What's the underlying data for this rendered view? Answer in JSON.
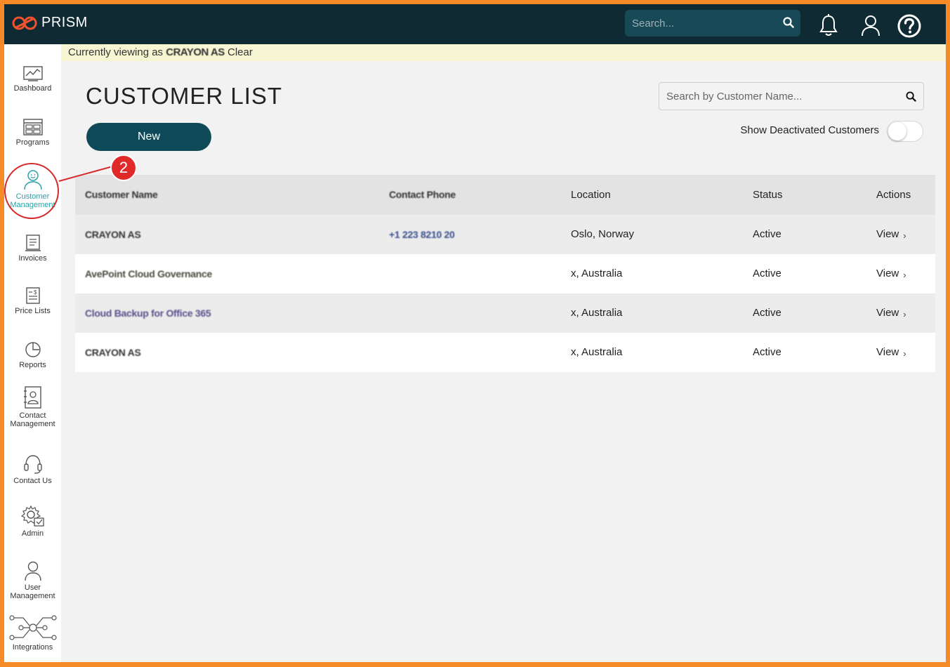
{
  "app": {
    "name": "PRISM"
  },
  "topbar": {
    "search_placeholder": "Search..."
  },
  "sidebar": {
    "items": [
      {
        "label": "Dashboard"
      },
      {
        "label": "Programs"
      },
      {
        "label": "Customer Management"
      },
      {
        "label": "Invoices"
      },
      {
        "label": "Price Lists"
      },
      {
        "label": "Reports"
      },
      {
        "label": "Contact Management"
      },
      {
        "label": "Contact Us"
      },
      {
        "label": "Admin"
      },
      {
        "label": "User Management"
      },
      {
        "label": "Integrations"
      }
    ]
  },
  "banner": {
    "lead": "Currently viewing as",
    "customer": "CRAYON AS",
    "clear": "Clear"
  },
  "page": {
    "title": "CUSTOMER LIST",
    "new_button": "New",
    "search_placeholder": "Search by Customer Name...",
    "toggle_label": "Show Deactivated Customers",
    "toggle_on": false
  },
  "annotation": {
    "number": "2"
  },
  "table": {
    "headers": [
      "Customer Name",
      "Contact Phone",
      "Location",
      "Status",
      "Actions"
    ],
    "rows": [
      {
        "name": "CRAYON AS",
        "phone": "+1 223 8210 20",
        "location": "Oslo, Norway",
        "status": "Active",
        "action": "View"
      },
      {
        "name": "AvePoint Cloud Governance",
        "phone": "",
        "location": "x, Australia",
        "status": "Active",
        "action": "View"
      },
      {
        "name": "Cloud Backup for Office 365",
        "phone": "",
        "location": "x, Australia",
        "status": "Active",
        "action": "View"
      },
      {
        "name": "CRAYON AS",
        "phone": "",
        "location": "x, Australia",
        "status": "Active",
        "action": "View"
      }
    ]
  },
  "colors": {
    "frame_border": "#f58a27",
    "topbar": "#0f2a33",
    "accent": "#0f4a58",
    "active_nav": "#2aa2a7",
    "annotation": "#e02a2a",
    "banner": "#f7f6d3"
  }
}
